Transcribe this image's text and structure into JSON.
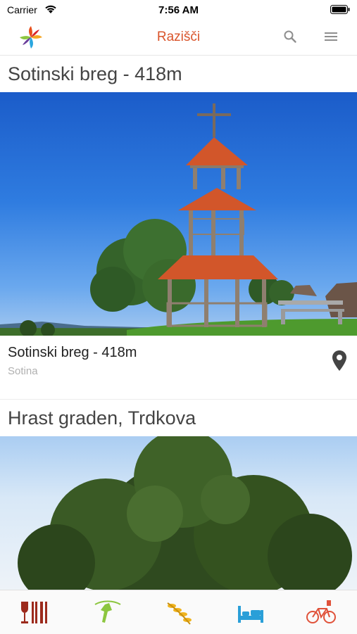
{
  "status": {
    "carrier": "Carrier",
    "time": "7:56 AM"
  },
  "nav": {
    "title": "Razišči"
  },
  "cards": [
    {
      "header": "Sotinski breg - 418m",
      "title": "Sotinski breg - 418m",
      "subtitle": "Sotina"
    },
    {
      "header": "Hrast graden, Trdkova"
    }
  ],
  "icons": {
    "logo": "app-logo",
    "search": "search-icon",
    "menu": "menu-icon",
    "pin": "location-pin-icon",
    "tabs": [
      "food-drink-icon",
      "hiking-icon",
      "agriculture-icon",
      "accommodation-icon",
      "cycling-icon"
    ]
  },
  "colors": {
    "accent": "#d9542b",
    "tab_food": "#9c2a1c",
    "tab_hiking": "#8cc63f",
    "tab_agri": "#f0b41e",
    "tab_bed": "#2a9fd8",
    "tab_bike": "#e0523a"
  }
}
